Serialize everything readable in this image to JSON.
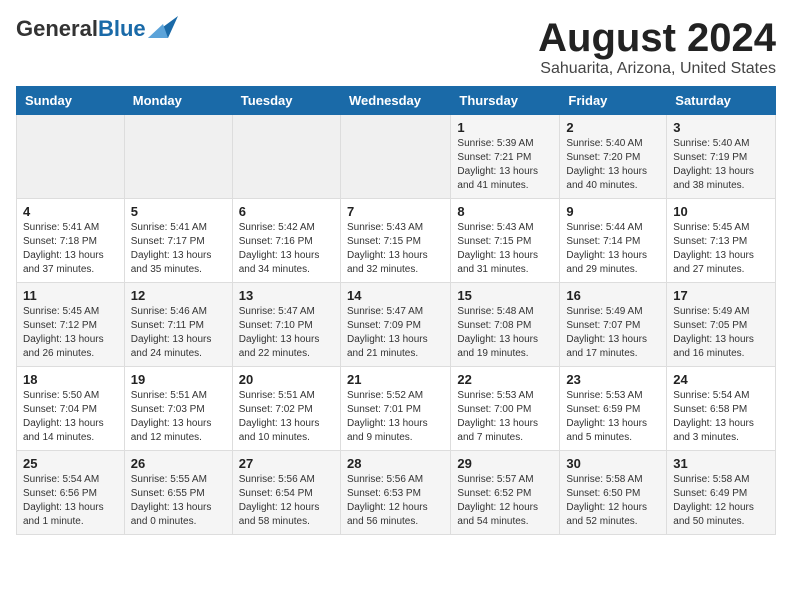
{
  "header": {
    "logo_general": "General",
    "logo_blue": "Blue",
    "month_title": "August 2024",
    "location": "Sahuarita, Arizona, United States"
  },
  "weekdays": [
    "Sunday",
    "Monday",
    "Tuesday",
    "Wednesday",
    "Thursday",
    "Friday",
    "Saturday"
  ],
  "weeks": [
    [
      {
        "day": "",
        "info": ""
      },
      {
        "day": "",
        "info": ""
      },
      {
        "day": "",
        "info": ""
      },
      {
        "day": "",
        "info": ""
      },
      {
        "day": "1",
        "info": "Sunrise: 5:39 AM\nSunset: 7:21 PM\nDaylight: 13 hours\nand 41 minutes."
      },
      {
        "day": "2",
        "info": "Sunrise: 5:40 AM\nSunset: 7:20 PM\nDaylight: 13 hours\nand 40 minutes."
      },
      {
        "day": "3",
        "info": "Sunrise: 5:40 AM\nSunset: 7:19 PM\nDaylight: 13 hours\nand 38 minutes."
      }
    ],
    [
      {
        "day": "4",
        "info": "Sunrise: 5:41 AM\nSunset: 7:18 PM\nDaylight: 13 hours\nand 37 minutes."
      },
      {
        "day": "5",
        "info": "Sunrise: 5:41 AM\nSunset: 7:17 PM\nDaylight: 13 hours\nand 35 minutes."
      },
      {
        "day": "6",
        "info": "Sunrise: 5:42 AM\nSunset: 7:16 PM\nDaylight: 13 hours\nand 34 minutes."
      },
      {
        "day": "7",
        "info": "Sunrise: 5:43 AM\nSunset: 7:15 PM\nDaylight: 13 hours\nand 32 minutes."
      },
      {
        "day": "8",
        "info": "Sunrise: 5:43 AM\nSunset: 7:15 PM\nDaylight: 13 hours\nand 31 minutes."
      },
      {
        "day": "9",
        "info": "Sunrise: 5:44 AM\nSunset: 7:14 PM\nDaylight: 13 hours\nand 29 minutes."
      },
      {
        "day": "10",
        "info": "Sunrise: 5:45 AM\nSunset: 7:13 PM\nDaylight: 13 hours\nand 27 minutes."
      }
    ],
    [
      {
        "day": "11",
        "info": "Sunrise: 5:45 AM\nSunset: 7:12 PM\nDaylight: 13 hours\nand 26 minutes."
      },
      {
        "day": "12",
        "info": "Sunrise: 5:46 AM\nSunset: 7:11 PM\nDaylight: 13 hours\nand 24 minutes."
      },
      {
        "day": "13",
        "info": "Sunrise: 5:47 AM\nSunset: 7:10 PM\nDaylight: 13 hours\nand 22 minutes."
      },
      {
        "day": "14",
        "info": "Sunrise: 5:47 AM\nSunset: 7:09 PM\nDaylight: 13 hours\nand 21 minutes."
      },
      {
        "day": "15",
        "info": "Sunrise: 5:48 AM\nSunset: 7:08 PM\nDaylight: 13 hours\nand 19 minutes."
      },
      {
        "day": "16",
        "info": "Sunrise: 5:49 AM\nSunset: 7:07 PM\nDaylight: 13 hours\nand 17 minutes."
      },
      {
        "day": "17",
        "info": "Sunrise: 5:49 AM\nSunset: 7:05 PM\nDaylight: 13 hours\nand 16 minutes."
      }
    ],
    [
      {
        "day": "18",
        "info": "Sunrise: 5:50 AM\nSunset: 7:04 PM\nDaylight: 13 hours\nand 14 minutes."
      },
      {
        "day": "19",
        "info": "Sunrise: 5:51 AM\nSunset: 7:03 PM\nDaylight: 13 hours\nand 12 minutes."
      },
      {
        "day": "20",
        "info": "Sunrise: 5:51 AM\nSunset: 7:02 PM\nDaylight: 13 hours\nand 10 minutes."
      },
      {
        "day": "21",
        "info": "Sunrise: 5:52 AM\nSunset: 7:01 PM\nDaylight: 13 hours\nand 9 minutes."
      },
      {
        "day": "22",
        "info": "Sunrise: 5:53 AM\nSunset: 7:00 PM\nDaylight: 13 hours\nand 7 minutes."
      },
      {
        "day": "23",
        "info": "Sunrise: 5:53 AM\nSunset: 6:59 PM\nDaylight: 13 hours\nand 5 minutes."
      },
      {
        "day": "24",
        "info": "Sunrise: 5:54 AM\nSunset: 6:58 PM\nDaylight: 13 hours\nand 3 minutes."
      }
    ],
    [
      {
        "day": "25",
        "info": "Sunrise: 5:54 AM\nSunset: 6:56 PM\nDaylight: 13 hours\nand 1 minute."
      },
      {
        "day": "26",
        "info": "Sunrise: 5:55 AM\nSunset: 6:55 PM\nDaylight: 13 hours\nand 0 minutes."
      },
      {
        "day": "27",
        "info": "Sunrise: 5:56 AM\nSunset: 6:54 PM\nDaylight: 12 hours\nand 58 minutes."
      },
      {
        "day": "28",
        "info": "Sunrise: 5:56 AM\nSunset: 6:53 PM\nDaylight: 12 hours\nand 56 minutes."
      },
      {
        "day": "29",
        "info": "Sunrise: 5:57 AM\nSunset: 6:52 PM\nDaylight: 12 hours\nand 54 minutes."
      },
      {
        "day": "30",
        "info": "Sunrise: 5:58 AM\nSunset: 6:50 PM\nDaylight: 12 hours\nand 52 minutes."
      },
      {
        "day": "31",
        "info": "Sunrise: 5:58 AM\nSunset: 6:49 PM\nDaylight: 12 hours\nand 50 minutes."
      }
    ]
  ]
}
